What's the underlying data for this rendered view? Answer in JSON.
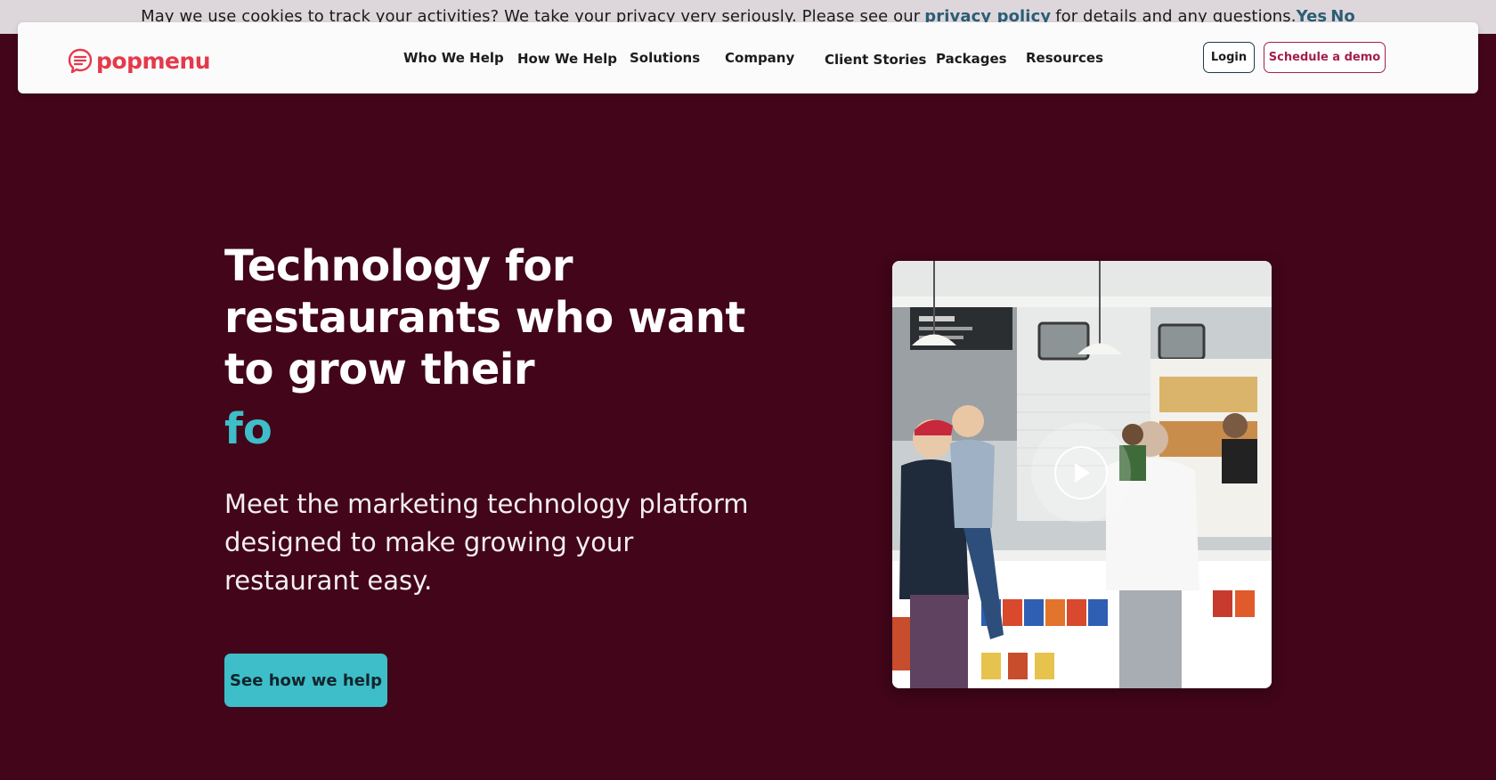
{
  "cookie_bar": {
    "text_before": "May we use cookies to track your activities? We take your privacy very seriously. Please see our",
    "link": "privacy policy",
    "text_after": "for details and any questions.",
    "yes": "Yes",
    "no": "No"
  },
  "header": {
    "logo_text": "popmenu",
    "nav": [
      "Who We Help",
      "How We Help",
      "Solutions",
      "Company",
      "Client Stories",
      "Packages",
      "Resources"
    ],
    "login": "Login",
    "demo": "Schedule a demo"
  },
  "hero": {
    "title": "Technology for restaurants who want to grow their",
    "typed": "fo",
    "subtitle": "Meet the marketing technology platform designed to make growing your restaurant easy.",
    "cta": "See how we help"
  },
  "colors": {
    "background": "#42051a",
    "brand_red": "#e5394b",
    "accent_teal": "#3dbec8",
    "link_blue": "#2c5d74",
    "demo_border": "#a3204a"
  },
  "icons": {
    "logo": "chat-bubble-icon",
    "video_play": "play-icon"
  }
}
